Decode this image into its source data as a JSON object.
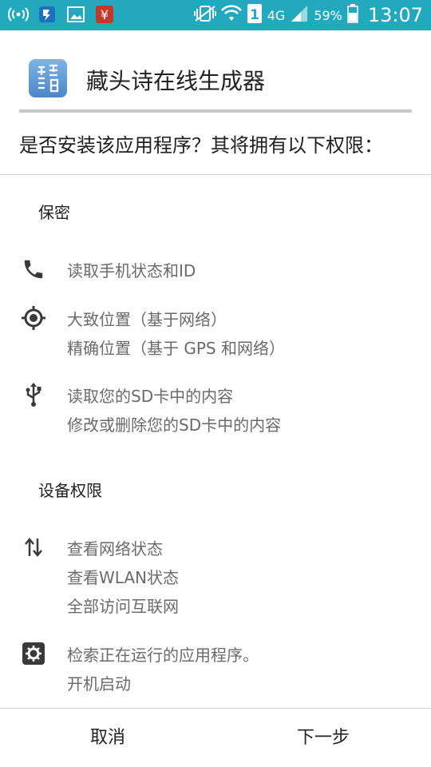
{
  "status_bar": {
    "battery_percent": "59%",
    "network": "4G",
    "time": "13:07",
    "background_color": "#22a9bd"
  },
  "app": {
    "title": "藏头诗在线生成器",
    "icon": "app-logo-icon"
  },
  "question": "是否安装该应用程序？其将拥有以下权限：",
  "sections": [
    {
      "title": "保密",
      "permissions": [
        {
          "icon": "phone-icon",
          "lines": [
            "读取手机状态和ID"
          ]
        },
        {
          "icon": "location-icon",
          "lines": [
            "大致位置（基于网络）",
            "精确位置（基于 GPS 和网络）"
          ]
        },
        {
          "icon": "usb-icon",
          "lines": [
            "读取您的SD卡中的内容",
            "修改或删除您的SD卡中的内容"
          ]
        }
      ]
    },
    {
      "title": "设备权限",
      "permissions": [
        {
          "icon": "network-arrows-icon",
          "lines": [
            "查看网络状态",
            "查看WLAN状态",
            "全部访问互联网"
          ]
        },
        {
          "icon": "settings-gear-icon",
          "lines": [
            "检索正在运行的应用程序。",
            "开机启动"
          ]
        }
      ]
    }
  ],
  "buttons": {
    "cancel": "取消",
    "next": "下一步"
  }
}
